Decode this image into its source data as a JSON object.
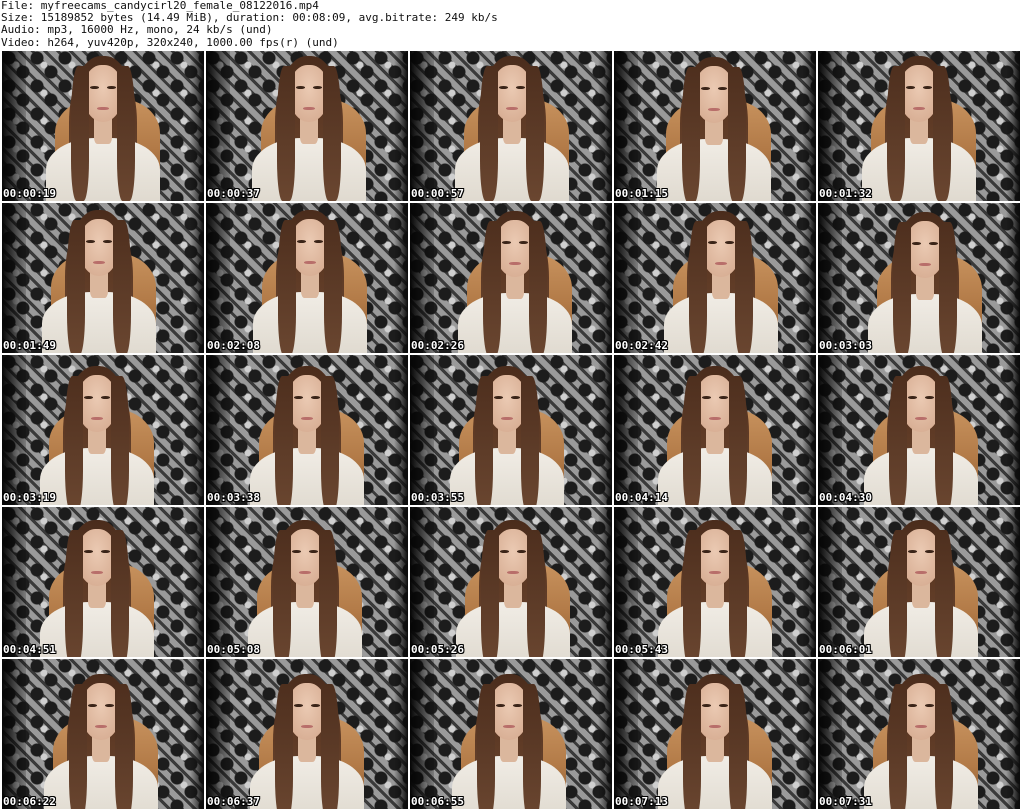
{
  "header": {
    "file": "File: myfreecams_candycirl20_female_08122016.mp4",
    "size": "Size: 15189852 bytes (14.49 MiB), duration: 00:08:09, avg.bitrate: 249 kb/s",
    "audio": "Audio: mp3, 16000 Hz, mono, 24 kb/s (und)",
    "video": "Video: h264, yuv420p, 320x240, 1000.00 fps(r) (und)"
  },
  "thumbnails": [
    {
      "timestamp": "00:00:19"
    },
    {
      "timestamp": "00:00:37"
    },
    {
      "timestamp": "00:00:57"
    },
    {
      "timestamp": "00:01:15"
    },
    {
      "timestamp": "00:01:32"
    },
    {
      "timestamp": "00:01:49"
    },
    {
      "timestamp": "00:02:08"
    },
    {
      "timestamp": "00:02:26"
    },
    {
      "timestamp": "00:02:42"
    },
    {
      "timestamp": "00:03:03"
    },
    {
      "timestamp": "00:03:19"
    },
    {
      "timestamp": "00:03:38"
    },
    {
      "timestamp": "00:03:55"
    },
    {
      "timestamp": "00:04:14"
    },
    {
      "timestamp": "00:04:30"
    },
    {
      "timestamp": "00:04:51"
    },
    {
      "timestamp": "00:05:08"
    },
    {
      "timestamp": "00:05:26"
    },
    {
      "timestamp": "00:05:43"
    },
    {
      "timestamp": "00:06:01"
    },
    {
      "timestamp": "00:06:22"
    },
    {
      "timestamp": "00:06:37"
    },
    {
      "timestamp": "00:06:55"
    },
    {
      "timestamp": "00:07:13"
    },
    {
      "timestamp": "00:07:31"
    }
  ],
  "colors": {
    "background": "#ffffff",
    "header_text": "#111111",
    "timestamp_text": "#ffffff",
    "timestamp_outline": "#000000"
  }
}
